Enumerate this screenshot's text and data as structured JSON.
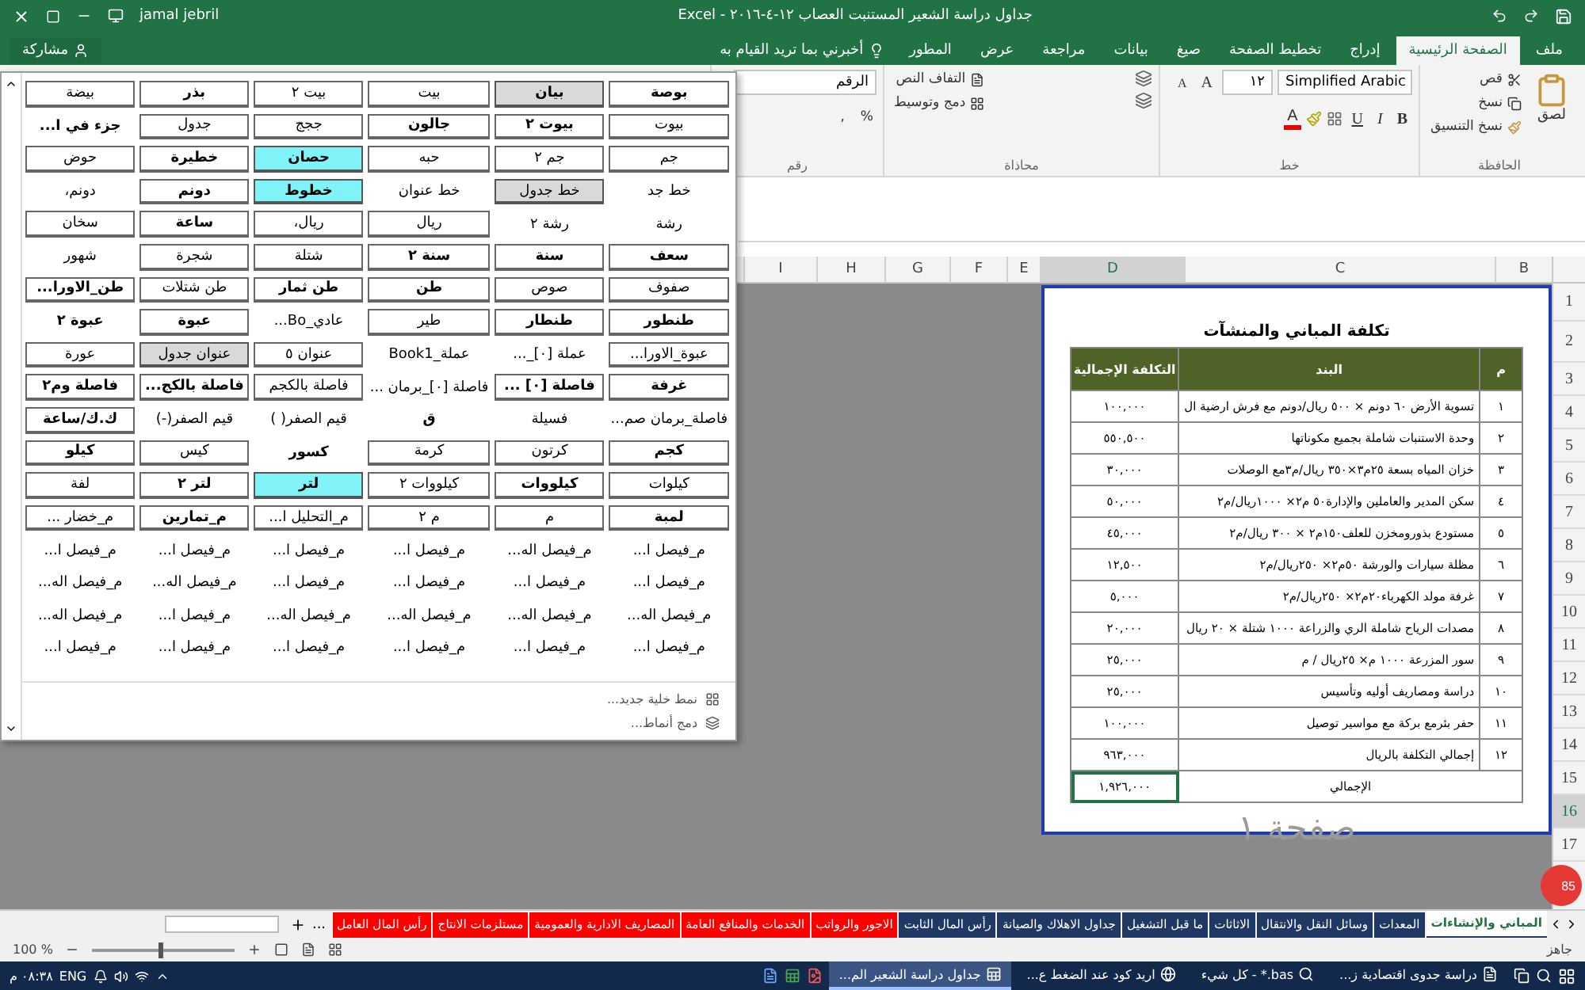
{
  "title_bar": {
    "title": "جداول دراسة الشعير المستنبت العصاب ١٢-٤-٢٠١٦ - Excel",
    "user": "jamal jebril"
  },
  "share_button": "مشاركة",
  "ribbon_tabs": [
    {
      "label": "ملف",
      "selected": false
    },
    {
      "label": "الصفحة الرئيسية",
      "selected": true
    },
    {
      "label": "إدراج",
      "selected": false
    },
    {
      "label": "تخطيط الصفحة",
      "selected": false
    },
    {
      "label": "صيغ",
      "selected": false
    },
    {
      "label": "بيانات",
      "selected": false
    },
    {
      "label": "مراجعة",
      "selected": false
    },
    {
      "label": "عرض",
      "selected": false
    },
    {
      "label": "المطور",
      "selected": false
    }
  ],
  "tell_me": "أخبرني بما تريد القيام به",
  "clipboard": {
    "label": "الحافظة",
    "paste": "لصق",
    "cut": "قص",
    "copy": "نسخ",
    "format_painter": "نسخ التنسيق"
  },
  "font": {
    "label": "خط",
    "font_name": "Simplified Arabic",
    "font_size": "١٢",
    "grow": "A",
    "shrink": "A",
    "toggles": [
      "B",
      "I",
      "U"
    ],
    "color_button": "A"
  },
  "alignment": {
    "label": "محاذاة",
    "wrap": "التفاف النص",
    "merge": "دمج وتوسيط"
  },
  "number": {
    "label": "رقم",
    "format": "الرقم",
    "percent": "%",
    "comma": ","
  },
  "styles_gallery": {
    "rows": [
      [
        {
          "text": "بوصة",
          "kind": "boxed",
          "bold": true
        },
        {
          "text": "بيان",
          "kind": "gray",
          "bold": true
        },
        {
          "text": "بيت",
          "kind": "boxed",
          "bold": false
        },
        {
          "text": "بيت ٢",
          "kind": "boxed",
          "bold": false
        },
        {
          "text": "بذر",
          "kind": "boxed",
          "bold": true
        },
        {
          "text": "بيضة",
          "kind": "boxed",
          "bold": false
        }
      ],
      [
        {
          "text": "بيوت",
          "kind": "boxed",
          "bold": false
        },
        {
          "text": "بيوت ٢",
          "kind": "boxed",
          "bold": true
        },
        {
          "text": "جالون",
          "kind": "boxed",
          "bold": true
        },
        {
          "text": "ججج",
          "kind": "boxed",
          "bold": false
        },
        {
          "text": "جدول",
          "kind": "boxed",
          "bold": false
        },
        {
          "text": "جزء في ا...",
          "kind": "plain",
          "bold": true
        }
      ],
      [
        {
          "text": "جم",
          "kind": "boxed",
          "bold": false
        },
        {
          "text": "جم ٢",
          "kind": "boxed",
          "bold": false
        },
        {
          "text": "حبه",
          "kind": "boxed",
          "bold": false
        },
        {
          "text": "حصان",
          "kind": "cyan",
          "bold": true
        },
        {
          "text": "خطيرة",
          "kind": "boxed",
          "bold": true
        },
        {
          "text": "حوض",
          "kind": "boxed",
          "bold": false
        }
      ],
      [
        {
          "text": "خط جد",
          "kind": "plain",
          "bold": false
        },
        {
          "text": "خط جدول",
          "kind": "gray",
          "bold": false
        },
        {
          "text": "خط عنوان",
          "kind": "plain",
          "bold": false
        },
        {
          "text": "خطوط",
          "kind": "cyan",
          "bold": true
        },
        {
          "text": "دونم",
          "kind": "boxed",
          "bold": true
        },
        {
          "text": "دونم،",
          "kind": "plain",
          "bold": false
        }
      ],
      [
        {
          "text": "رشة",
          "kind": "plain",
          "bold": false
        },
        {
          "text": "رشة ٢",
          "kind": "plain",
          "bold": false
        },
        {
          "text": "ريال",
          "kind": "boxed",
          "bold": false
        },
        {
          "text": "ريال،",
          "kind": "boxed",
          "bold": false
        },
        {
          "text": "ساعة",
          "kind": "boxed",
          "bold": true
        },
        {
          "text": "سخان",
          "kind": "boxed",
          "bold": false
        }
      ],
      [
        {
          "text": "سعف",
          "kind": "boxed",
          "bold": true
        },
        {
          "text": "سنة",
          "kind": "boxed",
          "bold": true
        },
        {
          "text": "سنة ٢",
          "kind": "boxed",
          "bold": true
        },
        {
          "text": "شتلة",
          "kind": "boxed",
          "bold": false
        },
        {
          "text": "شجرة",
          "kind": "boxed",
          "bold": false
        },
        {
          "text": "شهور",
          "kind": "plain",
          "bold": false
        }
      ],
      [
        {
          "text": "صفوف",
          "kind": "boxed",
          "bold": false
        },
        {
          "text": "صوص",
          "kind": "boxed",
          "bold": false
        },
        {
          "text": "طن",
          "kind": "boxed",
          "bold": true
        },
        {
          "text": "طن ثمار",
          "kind": "boxed",
          "bold": true
        },
        {
          "text": "طن شتلات",
          "kind": "boxed",
          "bold": false
        },
        {
          "text": "طن_الاورا...",
          "kind": "boxed",
          "bold": true
        }
      ],
      [
        {
          "text": "طنطور",
          "kind": "boxed",
          "bold": true
        },
        {
          "text": "طنطار",
          "kind": "boxed",
          "bold": true
        },
        {
          "text": "طير",
          "kind": "boxed",
          "bold": false
        },
        {
          "text": "عادي_Bo...",
          "kind": "plain",
          "bold": false
        },
        {
          "text": "عبوة",
          "kind": "boxed",
          "bold": true
        },
        {
          "text": "عبوة ٢",
          "kind": "plain",
          "bold": true
        }
      ],
      [
        {
          "text": "عبوة_الاورا...",
          "kind": "boxed",
          "bold": false
        },
        {
          "text": "عملة [٠]_...",
          "kind": "plain",
          "bold": false
        },
        {
          "text": "عملة_Book1",
          "kind": "plain",
          "bold": false
        },
        {
          "text": "عنوان ٥",
          "kind": "boxed",
          "bold": false
        },
        {
          "text": "عنوان جدول",
          "kind": "gray",
          "bold": false
        },
        {
          "text": "عورة",
          "kind": "boxed",
          "bold": false
        }
      ],
      [
        {
          "text": "غرفة",
          "kind": "boxed",
          "bold": true
        },
        {
          "text": "فاصلة [٠] ...",
          "kind": "boxed",
          "bold": true
        },
        {
          "text": "فاصلة [٠]_برمان ...",
          "kind": "plain",
          "bold": false
        },
        {
          "text": "فاصلة بالكجم",
          "kind": "boxed",
          "bold": false
        },
        {
          "text": "فاصلة بالكج...",
          "kind": "boxed",
          "bold": true
        },
        {
          "text": "فاصلة وم٢",
          "kind": "boxed",
          "bold": true
        }
      ],
      [
        {
          "text": "فاصلة_برمان صم...",
          "kind": "plain",
          "bold": false
        },
        {
          "text": "فسيلة",
          "kind": "plain",
          "bold": false
        },
        {
          "text": "ق",
          "kind": "plain",
          "bold": true
        },
        {
          "text": "قيم الصفر( )",
          "kind": "plain",
          "bold": false
        },
        {
          "text": "قيم الصفر(-)",
          "kind": "plain",
          "bold": false
        },
        {
          "text": "ك.ك/ساعة",
          "kind": "boxed",
          "bold": true
        }
      ],
      [
        {
          "text": "كجم",
          "kind": "boxed",
          "bold": true
        },
        {
          "text": "كرتون",
          "kind": "boxed",
          "bold": false
        },
        {
          "text": "كرمة",
          "kind": "boxed",
          "bold": false
        },
        {
          "text": "كسور",
          "kind": "plain",
          "bold": true
        },
        {
          "text": "كيس",
          "kind": "boxed",
          "bold": false
        },
        {
          "text": "كيلو",
          "kind": "boxed",
          "bold": true
        }
      ],
      [
        {
          "text": "كيلوات",
          "kind": "boxed",
          "bold": false
        },
        {
          "text": "كيلووات",
          "kind": "boxed",
          "bold": true
        },
        {
          "text": "كيلووات ٢",
          "kind": "boxed",
          "bold": false
        },
        {
          "text": "لتر",
          "kind": "cyan",
          "bold": true
        },
        {
          "text": "لتر ٢",
          "kind": "boxed",
          "bold": true
        },
        {
          "text": "لفة",
          "kind": "boxed",
          "bold": false
        }
      ],
      [
        {
          "text": "لمبة",
          "kind": "boxed",
          "bold": true
        },
        {
          "text": "م",
          "kind": "boxed",
          "bold": false
        },
        {
          "text": "م ٢",
          "kind": "boxed",
          "bold": false
        },
        {
          "text": "م_التحليل ا...",
          "kind": "boxed",
          "bold": false
        },
        {
          "text": "م_تمارين",
          "kind": "boxed",
          "bold": true
        },
        {
          "text": "م_خضار ...",
          "kind": "boxed",
          "bold": false
        }
      ],
      [
        {
          "text": "م_فيصل ا...",
          "kind": "plain",
          "bold": false
        },
        {
          "text": "م_فيصل اله...",
          "kind": "plain",
          "bold": false
        },
        {
          "text": "م_فيصل ا...",
          "kind": "plain",
          "bold": false
        },
        {
          "text": "م_فيصل ا...",
          "kind": "plain",
          "bold": false
        },
        {
          "text": "م_فيصل ا...",
          "kind": "plain",
          "bold": false
        },
        {
          "text": "م_فيصل ا...",
          "kind": "plain",
          "bold": false
        }
      ],
      [
        {
          "text": "م_فيصل ا...",
          "kind": "plain",
          "bold": false
        },
        {
          "text": "م_فيصل ا...",
          "kind": "plain",
          "bold": false
        },
        {
          "text": "م_فيصل ا...",
          "kind": "plain",
          "bold": false
        },
        {
          "text": "م_فيصل ا...",
          "kind": "plain",
          "bold": false
        },
        {
          "text": "م_فيصل اله...",
          "kind": "plain",
          "bold": false
        },
        {
          "text": "م_فيصل اله...",
          "kind": "plain",
          "bold": false
        }
      ],
      [
        {
          "text": "م_فيصل اله...",
          "kind": "plain",
          "bold": false
        },
        {
          "text": "م_فيصل اله...",
          "kind": "plain",
          "bold": false
        },
        {
          "text": "م_فيصل اله...",
          "kind": "plain",
          "bold": false
        },
        {
          "text": "م_فيصل اله...",
          "kind": "plain",
          "bold": false
        },
        {
          "text": "م_فيصل ا...",
          "kind": "plain",
          "bold": false
        },
        {
          "text": "م_فيصل اله...",
          "kind": "plain",
          "bold": false
        }
      ],
      [
        {
          "text": "م_فيصل ا...",
          "kind": "plain",
          "bold": false
        },
        {
          "text": "م_فيصل ا...",
          "kind": "plain",
          "bold": false
        },
        {
          "text": "م_فيصل ا...",
          "kind": "plain",
          "bold": false
        },
        {
          "text": "م_فيصل ا...",
          "kind": "plain",
          "bold": false
        },
        {
          "text": "م_فيصل ا...",
          "kind": "plain",
          "bold": false
        },
        {
          "text": "م_فيصل ا...",
          "kind": "plain",
          "bold": false
        }
      ]
    ],
    "new_style": "نمط خلية جديد...",
    "merge_styles": "دمج أنماط..."
  },
  "columns": [
    {
      "label": "B",
      "selected": false
    },
    {
      "label": "C",
      "selected": false
    },
    {
      "label": "D",
      "selected": true
    },
    {
      "label": "E",
      "selected": false
    },
    {
      "label": "F",
      "selected": false
    },
    {
      "label": "G",
      "selected": false
    },
    {
      "label": "H",
      "selected": false
    },
    {
      "label": "I",
      "selected": false
    }
  ],
  "row_numbers": [
    {
      "label": "1",
      "selected": false
    },
    {
      "label": "2",
      "selected": false
    },
    {
      "label": "3",
      "selected": false
    },
    {
      "label": "4",
      "selected": false
    },
    {
      "label": "5",
      "selected": false
    },
    {
      "label": "6",
      "selected": false
    },
    {
      "label": "7",
      "selected": false
    },
    {
      "label": "8",
      "selected": false
    },
    {
      "label": "9",
      "selected": false
    },
    {
      "label": "10",
      "selected": false
    },
    {
      "label": "11",
      "selected": false
    },
    {
      "label": "12",
      "selected": false
    },
    {
      "label": "13",
      "selected": false
    },
    {
      "label": "14",
      "selected": false
    },
    {
      "label": "15",
      "selected": false
    },
    {
      "label": "16",
      "selected": true
    },
    {
      "label": "17",
      "selected": false
    }
  ],
  "page": {
    "label": "صفحة ١",
    "title": "تكلفة المباني والمنشآت",
    "headers": [
      "م",
      "البند",
      "التكلفة الإجمالية"
    ],
    "rows": [
      [
        "١",
        "تسوية الأرض ٦٠ دونم × ٥٠٠ ريال/دونم مع فرش ارضية ال",
        "١٠٠,٠٠٠"
      ],
      [
        "٢",
        "وحدة الاستنبات شاملة بجميع مكوناتها",
        "٥٥٠,٥٠٠"
      ],
      [
        "٣",
        "خزان المياه بسعة ٢٥م٣×٣٥٠ ريال/م٣مع الوصلات",
        "٣٠,٠٠٠"
      ],
      [
        "٤",
        "سكن المدير والعاملين والإدارة٥٠ م٢× ١٠٠٠ريال/م٢",
        "٥٠,٠٠٠"
      ],
      [
        "٥",
        "مستودع بذورومخزن للعلف١٥٠م٢ × ٣٠٠ ريال/م٢",
        "٤٥,٠٠٠"
      ],
      [
        "٦",
        "مظلة سيارات والورشة ٥٠م٢× ٢٥٠ريال/م٢",
        "١٢,٥٠٠"
      ],
      [
        "٧",
        "غرفة مولد الكهرباء٢٠م٢× ٢٥٠ريال/م٢",
        "٥,٠٠٠"
      ],
      [
        "٨",
        "مصدات الرياح شاملة الري والزراعة ١٠٠٠ شتلة × ٢٠ ريال",
        "٢٠,٠٠٠"
      ],
      [
        "٩",
        "سور المزرعة ١٠٠٠ م× ٢٥ريال / م",
        "٢٥,٠٠٠"
      ],
      [
        "١٠",
        "دراسة ومصاريف أوليه وتأسيس",
        "٢٥,٠٠٠"
      ],
      [
        "١١",
        "حفر بئرمع بركة مع مواسير توصيل",
        "١٠٠,٠٠٠"
      ],
      [
        "١٢",
        "إجمالي التكلفة بالريال",
        "٩٦٣,٠٠٠"
      ]
    ],
    "total_label": "الإجمالي",
    "total_value": "١,٩٢٦,٠٠٠"
  },
  "badge": "85",
  "sheet_tabs": [
    {
      "label": "المباني والإنشاءات",
      "selected": true,
      "color": "#1f3864"
    },
    {
      "label": "المعدات",
      "selected": false,
      "color": "#1f3864"
    },
    {
      "label": "وسائل النقل والانتقال",
      "selected": false,
      "color": "#1f3864"
    },
    {
      "label": "الاثاثات",
      "selected": false,
      "color": "#1f3864"
    },
    {
      "label": "ما قبل التشغيل",
      "selected": false,
      "color": "#1f3864"
    },
    {
      "label": "جداول الاهلاك والصيانة",
      "selected": false,
      "color": "#1f3864"
    },
    {
      "label": "رأس المال الثابت",
      "selected": false,
      "color": "#1f3864"
    },
    {
      "label": "الاجور والرواتب",
      "selected": false,
      "color": "#ff0000"
    },
    {
      "label": "الخدمات والمنافع العامة",
      "selected": false,
      "color": "#ff0000"
    },
    {
      "label": "المصاريف الادارية والعمومية",
      "selected": false,
      "color": "#ff0000"
    },
    {
      "label": "مستلزمات الانتاج",
      "selected": false,
      "color": "#ff0000"
    },
    {
      "label": "رأس المال العامل",
      "selected": false,
      "color": "#ff0000"
    }
  ],
  "more_tabs": "...",
  "status": {
    "ready": "جاهز",
    "zoom": "100 %",
    "level": 0.5
  },
  "taskbar": {
    "apps": [
      {
        "label": "دراسة جدوى اقتصادية ز...",
        "kind": "word",
        "selected": false
      },
      {
        "label": "bas.* - كل شيء",
        "kind": "search",
        "selected": false
      },
      {
        "label": "اريد كود عند الضغط ع...",
        "kind": "browser",
        "selected": false
      },
      {
        "label": "جداول دراسة الشعير الم...",
        "kind": "excel",
        "selected": true
      }
    ],
    "language": "ENG",
    "time": "٠٨:٣٨ م"
  }
}
